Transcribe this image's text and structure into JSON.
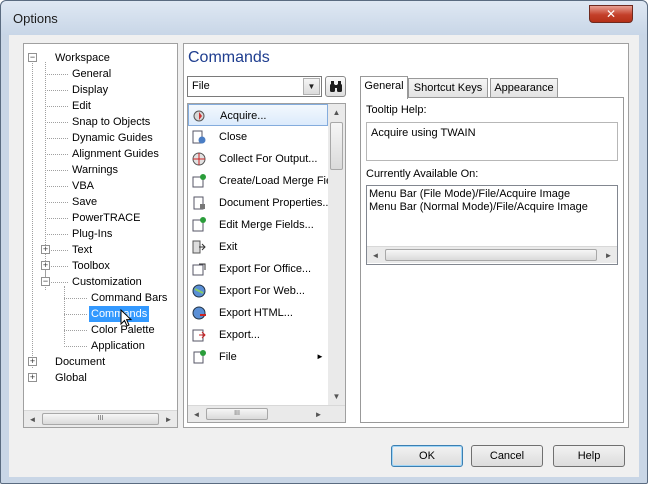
{
  "window": {
    "title": "Options",
    "close_glyph": "✕"
  },
  "tree": {
    "nodes": [
      {
        "label": "Workspace",
        "expander": "−"
      },
      {
        "label": "General"
      },
      {
        "label": "Display"
      },
      {
        "label": "Edit"
      },
      {
        "label": "Snap to Objects"
      },
      {
        "label": "Dynamic Guides"
      },
      {
        "label": "Alignment Guides"
      },
      {
        "label": "Warnings"
      },
      {
        "label": "VBA"
      },
      {
        "label": "Save"
      },
      {
        "label": "PowerTRACE"
      },
      {
        "label": "Plug-Ins"
      },
      {
        "label": "Text",
        "expander": "+"
      },
      {
        "label": "Toolbox",
        "expander": "+"
      },
      {
        "label": "Customization",
        "expander": "−"
      },
      {
        "label": "Command Bars"
      },
      {
        "label": "Commands",
        "selected": true
      },
      {
        "label": "Color Palette"
      },
      {
        "label": "Application"
      },
      {
        "label": "Document",
        "expander": "+"
      },
      {
        "label": "Global",
        "expander": "+"
      }
    ],
    "scroll": {
      "left": "◄",
      "right": "►",
      "grip": "III"
    }
  },
  "panel": {
    "title": "Commands",
    "category_selected": "File",
    "combo_arrow": "▼",
    "commands": [
      {
        "label": "Acquire...",
        "icon": "acquire-icon",
        "selected": true
      },
      {
        "label": "Close",
        "icon": "close-document-icon"
      },
      {
        "label": "Collect For Output...",
        "icon": "collect-output-icon"
      },
      {
        "label": "Create/Load Merge Fie",
        "icon": "merge-fields-icon"
      },
      {
        "label": "Document Properties...",
        "icon": "document-properties-icon"
      },
      {
        "label": "Edit Merge Fields...",
        "icon": "edit-merge-icon"
      },
      {
        "label": "Exit",
        "icon": "exit-icon"
      },
      {
        "label": "Export For Office...",
        "icon": "export-office-icon"
      },
      {
        "label": "Export For Web...",
        "icon": "export-web-icon"
      },
      {
        "label": "Export HTML...",
        "icon": "export-html-icon"
      },
      {
        "label": "Export...",
        "icon": "export-icon"
      },
      {
        "label": "File",
        "icon": "file-menu-icon",
        "submenu": "►"
      }
    ],
    "list_scroll": {
      "up": "▲",
      "down": "▼",
      "left": "◄",
      "right": "►",
      "grip": "III"
    }
  },
  "tabs": [
    {
      "label": "General",
      "active": true
    },
    {
      "label": "Shortcut Keys"
    },
    {
      "label": "Appearance"
    }
  ],
  "general": {
    "tooltip_label": "Tooltip Help:",
    "tooltip_value": "Acquire using TWAIN",
    "available_label": "Currently Available On:",
    "available_items": [
      "Menu Bar (File Mode)/File/Acquire Image",
      "Menu Bar (Normal Mode)/File/Acquire Image"
    ]
  },
  "buttons": {
    "ok": "OK",
    "cancel": "Cancel",
    "help": "Help"
  },
  "colors": {
    "title_blue": "#1e3d8f",
    "selection": "#3399ff",
    "close_red": "#c4402a"
  }
}
